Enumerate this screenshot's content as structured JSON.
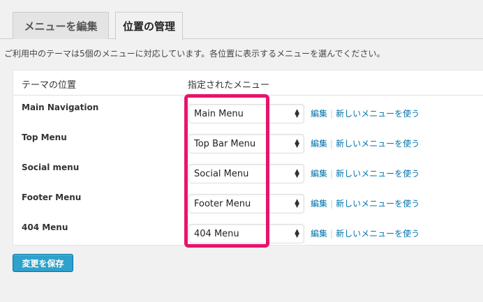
{
  "tabs": [
    {
      "label": "メニューを編集"
    },
    {
      "label": "位置の管理"
    }
  ],
  "description": "ご利用中のテーマは5個のメニューに対応しています。各位置に表示するメニューを選んでください。",
  "table": {
    "col_location": "テーマの位置",
    "col_menu": "指定されたメニュー",
    "rows": [
      {
        "location": "Main Navigation",
        "menu": "Main Menu",
        "edit": "編集",
        "new": "新しいメニューを使う"
      },
      {
        "location": "Top Menu",
        "menu": "Top Bar Menu",
        "edit": "編集",
        "new": "新しいメニューを使う"
      },
      {
        "location": "Social menu",
        "menu": "Social Menu",
        "edit": "編集",
        "new": "新しいメニューを使う"
      },
      {
        "location": "Footer Menu",
        "menu": "Footer Menu",
        "edit": "編集",
        "new": "新しいメニューを使う"
      },
      {
        "location": "404 Menu",
        "menu": "404 Menu",
        "edit": "編集",
        "new": "新しいメニューを使う"
      }
    ]
  },
  "save_label": "変更を保存",
  "colors": {
    "highlight": "#e8136b",
    "link": "#0073aa",
    "button": "#2ea2cc"
  }
}
